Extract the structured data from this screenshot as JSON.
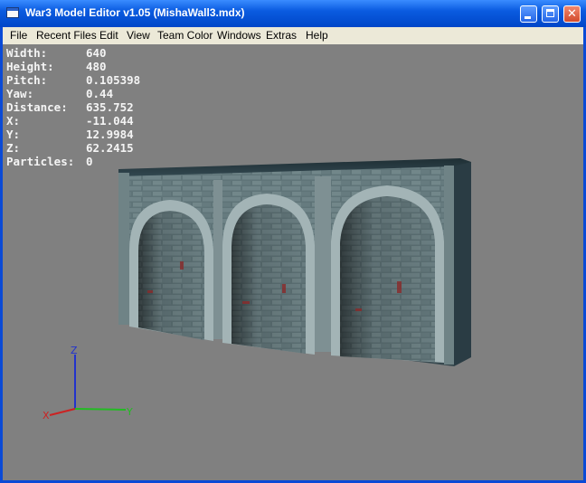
{
  "window": {
    "title": "War3 Model Editor v1.05 (MishaWall3.mdx)",
    "minimize_glyph": "",
    "maximize_glyph": "",
    "close_glyph": "✕"
  },
  "menu": {
    "items": [
      "File",
      "Recent Files",
      "Edit",
      "View",
      "Team Color",
      "Windows",
      "Extras",
      "Help"
    ]
  },
  "info": [
    {
      "label": "Width:",
      "value": "640"
    },
    {
      "label": "Height:",
      "value": "480"
    },
    {
      "label": "Pitch:",
      "value": "0.105398"
    },
    {
      "label": "Yaw:",
      "value": "0.44"
    },
    {
      "label": "Distance:",
      "value": "635.752"
    },
    {
      "label": "X:",
      "value": "-11.044"
    },
    {
      "label": "Y:",
      "value": "12.9984"
    },
    {
      "label": "Z:",
      "value": "62.2415"
    },
    {
      "label": "Particles:",
      "value": "0"
    }
  ],
  "axes": {
    "x_label": "X",
    "y_label": "Y",
    "z_label": "Z",
    "x_color": "#cc2222",
    "y_color": "#22bb22",
    "z_color": "#2233cc"
  },
  "colors": {
    "titlebar": "#0a5be0",
    "menubar": "#ece9d8",
    "viewport": "#808080",
    "wall_stone": "#5f7478"
  },
  "icons": {
    "app": "window-icon",
    "minimize": "minimize-icon",
    "maximize": "maximize-icon",
    "close": "close-icon"
  }
}
